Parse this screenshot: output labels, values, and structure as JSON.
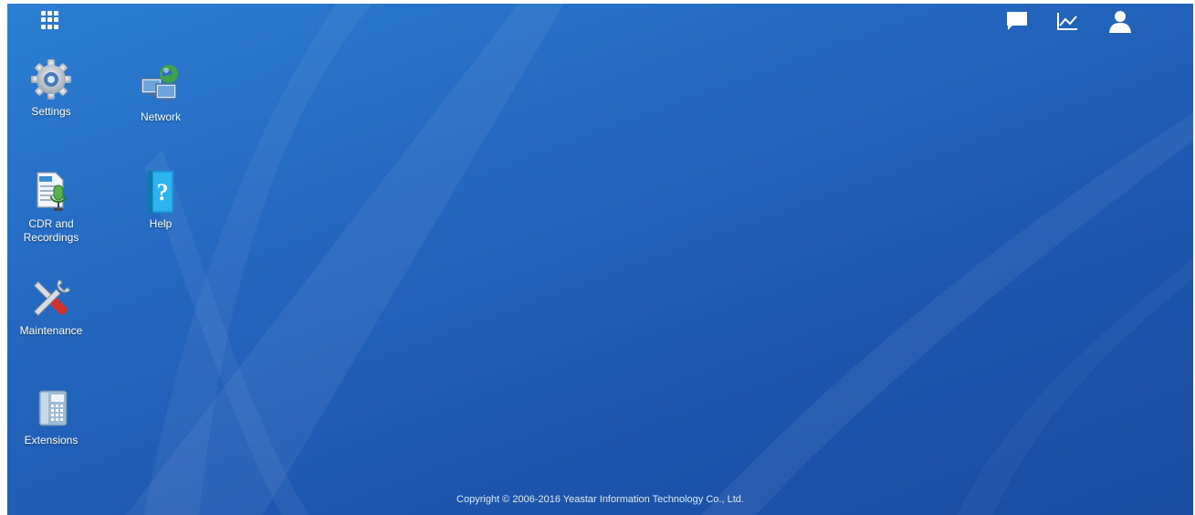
{
  "desktop": {
    "apps_launcher_icon": "grid-icon",
    "top_bar": {
      "icons": [
        "chat-icon",
        "chart-line-icon",
        "user-icon"
      ]
    },
    "items": [
      {
        "label": "Settings",
        "icon": "gear-icon"
      },
      {
        "label": "Network",
        "icon": "network-globe-icon"
      },
      {
        "label": "CDR and\nRecordings",
        "icon": "cdr-recordings-icon"
      },
      {
        "label": "Help",
        "icon": "help-book-icon"
      },
      {
        "label": "Maintenance",
        "icon": "tools-icon"
      },
      {
        "label": "Extensions",
        "icon": "desk-phone-icon"
      }
    ],
    "footer": {
      "copyright": "Copyright © 2006-2016 Yeastar Information Technology Co., Ltd."
    },
    "colors": {
      "background": "#2468c0",
      "text": "#ffffff"
    }
  }
}
